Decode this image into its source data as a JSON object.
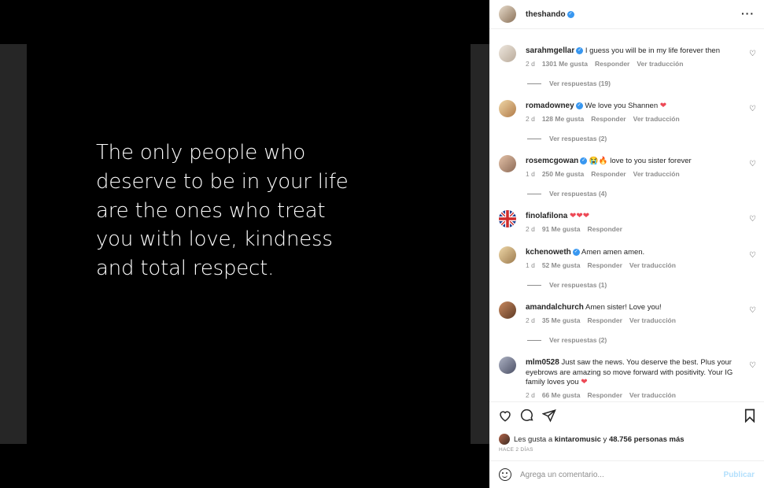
{
  "post": {
    "quote_lines": [
      "The only people who",
      "deserve to be in your life",
      "are the ones who treat",
      "you with love, kindness",
      "and total respect."
    ]
  },
  "header": {
    "username": "theshando",
    "more_icon": "more-horizontal-icon"
  },
  "comments": [
    {
      "user": "sarahmgellar",
      "verified": true,
      "text": "I guess you will be in my life forever then",
      "time": "2 d",
      "likes": "1301 Me gusta",
      "reply": "Responder",
      "translate": "Ver traducción",
      "replies": "Ver respuestas (19)",
      "avatar_color": "#d9d2cb"
    },
    {
      "user": "romadowney",
      "verified": true,
      "text": "We love you Shannen",
      "emoji": "❤",
      "time": "2 d",
      "likes": "128 Me gusta",
      "reply": "Responder",
      "translate": "Ver traducción",
      "replies": "Ver respuestas (2)",
      "avatar_color": "#d8a870"
    },
    {
      "user": "rosemcgowan",
      "verified": true,
      "emoji_prefix": "😭🔥",
      "text": "love to you sister forever",
      "time": "1 d",
      "likes": "250 Me gusta",
      "reply": "Responder",
      "translate": "Ver traducción",
      "replies": "Ver respuestas (4)",
      "avatar_color": "#c99e84"
    },
    {
      "user": "finolafilona",
      "verified": false,
      "emoji": "❤❤❤",
      "time": "2 d",
      "likes": "91 Me gusta",
      "reply": "Responder",
      "avatar_color": "#2c4ea0"
    },
    {
      "user": "kchenoweth",
      "verified": true,
      "text": "Amen amen amen.",
      "time": "1 d",
      "likes": "52 Me gusta",
      "reply": "Responder",
      "translate": "Ver traducción",
      "replies": "Ver respuestas (1)",
      "avatar_color": "#d6b98a"
    },
    {
      "user": "amandalchurch",
      "verified": false,
      "text": "Amen sister! Love you!",
      "time": "2 d",
      "likes": "35 Me gusta",
      "reply": "Responder",
      "translate": "Ver traducción",
      "replies": "Ver respuestas (2)",
      "avatar_color": "#a86b45"
    },
    {
      "user": "mlm0528",
      "verified": false,
      "text": "Just saw the news. You deserve the best. Plus your eyebrows are amazing so move forward with positivity. Your IG family loves you",
      "emoji": "❤",
      "time": "2 d",
      "likes": "66 Me gusta",
      "reply": "Responder",
      "translate": "Ver traducción",
      "avatar_color": "#7a7d8c"
    }
  ],
  "actions": {
    "likes_prefix": "Les gusta a",
    "likes_user": "kintaromusic",
    "likes_conj": "y",
    "likes_count": "48.756 personas más",
    "timestamp": "HACE 2 DÍAS"
  },
  "comment_box": {
    "placeholder": "Agrega un comentario...",
    "post_label": "Publicar"
  },
  "colors": {
    "accent": "#3897f0",
    "heart": "#ed4956",
    "muted": "#8e8e8e",
    "post_disabled": "#b2dffc"
  }
}
